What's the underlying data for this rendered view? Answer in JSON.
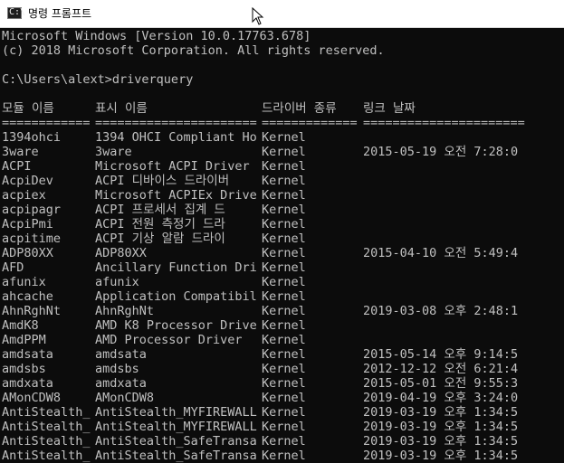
{
  "window": {
    "title": "명령 프롬프트",
    "title_glyph": "C:\\",
    "bg": "#0c0c0c",
    "fg": "#c0c0c0"
  },
  "console": {
    "version_line": "Microsoft Windows [Version 10.0.17763.678]",
    "copyright_line": "(c) 2018 Microsoft Corporation. All rights reserved.",
    "prompt": "C:\\Users\\alext>driverquery",
    "headers": [
      "모듈 이름",
      "표시 이름",
      "드라이버 종류",
      "링크 날짜"
    ],
    "separators": [
      "============",
      "======================",
      "=============",
      "======================"
    ],
    "rows": [
      [
        "1394ohci",
        "1394 OHCI Compliant Ho",
        "Kernel",
        ""
      ],
      [
        "3ware",
        "3ware",
        "Kernel",
        "2015-05-19 오전 7:28:0"
      ],
      [
        "ACPI",
        "Microsoft ACPI Driver",
        "Kernel",
        ""
      ],
      [
        "AcpiDev",
        "ACPI 디바이스 드라이버",
        "Kernel",
        ""
      ],
      [
        "acpiex",
        "Microsoft ACPIEx Drive",
        "Kernel",
        ""
      ],
      [
        "acpipagr",
        "ACPI 프로세서 집계 드",
        "Kernel",
        ""
      ],
      [
        "AcpiPmi",
        "ACPI 전원 측정기 드라",
        "Kernel",
        ""
      ],
      [
        "acpitime",
        "ACPI 기상 알람 드라이",
        "Kernel",
        ""
      ],
      [
        "ADP80XX",
        "ADP80XX",
        "Kernel",
        "2015-04-10 오전 5:49:4"
      ],
      [
        "AFD",
        "Ancillary Function Dri",
        "Kernel",
        ""
      ],
      [
        "afunix",
        "afunix",
        "Kernel",
        ""
      ],
      [
        "ahcache",
        "Application Compatibil",
        "Kernel",
        ""
      ],
      [
        "AhnRghNt",
        "AhnRghNt",
        "Kernel",
        "2019-03-08 오후 2:48:1"
      ],
      [
        "AmdK8",
        "AMD K8 Processor Drive",
        "Kernel",
        ""
      ],
      [
        "AmdPPM",
        "AMD Processor Driver",
        "Kernel",
        ""
      ],
      [
        "amdsata",
        "amdsata",
        "Kernel",
        "2015-05-14 오후 9:14:5"
      ],
      [
        "amdsbs",
        "amdsbs",
        "Kernel",
        "2012-12-12 오전 6:21:4"
      ],
      [
        "amdxata",
        "amdxata",
        "Kernel",
        "2015-05-01 오전 9:55:3"
      ],
      [
        "AMonCDW8",
        "AMonCDW8",
        "Kernel",
        "2019-04-19 오후 3:24:0"
      ],
      [
        "AntiStealth_",
        "AntiStealth_MYFIREWALL",
        "Kernel",
        "2019-03-19 오후 1:34:5"
      ],
      [
        "AntiStealth_",
        "AntiStealth_MYFIREWALL",
        "Kernel",
        "2019-03-19 오후 1:34:5"
      ],
      [
        "AntiStealth_",
        "AntiStealth_SafeTransa",
        "Kernel",
        "2019-03-19 오후 1:34:5"
      ],
      [
        "AntiStealth_",
        "AntiStealth_SafeTransa",
        "Kernel",
        "2019-03-19 오후 1:34:5"
      ]
    ]
  }
}
